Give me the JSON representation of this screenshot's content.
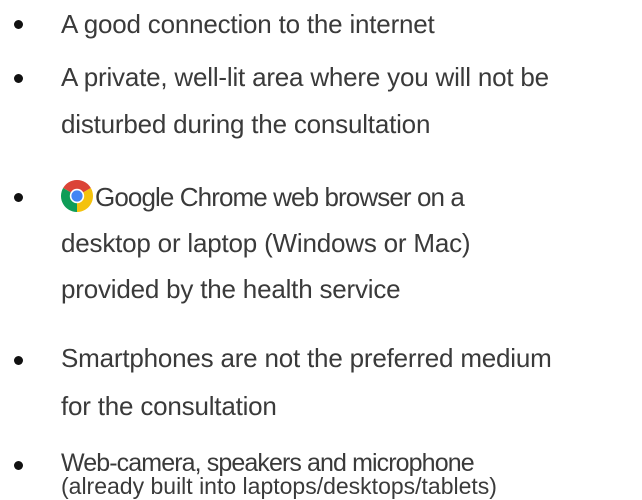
{
  "items": [
    {
      "lines": [
        "A good connection to the internet"
      ]
    },
    {
      "lines": [
        "A private, well-lit area where you will not be",
        "disturbed during the consultation"
      ]
    },
    {
      "icon": "chrome-icon",
      "lines": [
        "Google Chrome web browser on a",
        "desktop or laptop (Windows or Mac)",
        "provided by the health service"
      ]
    },
    {
      "lines": [
        "Smartphones are not the preferred medium",
        "for the consultation"
      ]
    },
    {
      "lines": [
        "Web-camera, speakers and microphone",
        "(already built into laptops/desktops/tablets)"
      ]
    }
  ],
  "colors": {
    "text": "#3a3a3a",
    "bullet": "#111111",
    "chrome_red": "#db4437",
    "chrome_yellow": "#f4c20d",
    "chrome_green": "#0f9d58",
    "chrome_blue": "#4285f4"
  }
}
